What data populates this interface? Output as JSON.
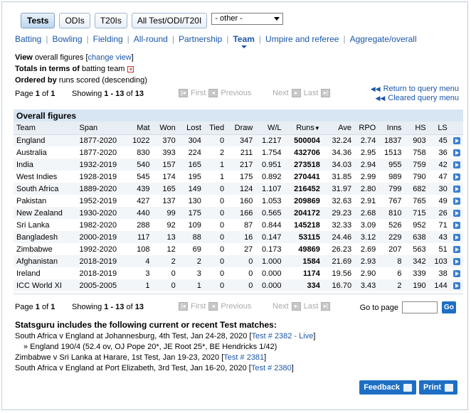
{
  "tabs": [
    {
      "label": "Tests",
      "active": true
    },
    {
      "label": "ODIs",
      "active": false
    },
    {
      "label": "T20Is",
      "active": false
    },
    {
      "label": "All Test/ODI/T20I",
      "active": false
    }
  ],
  "other_select": {
    "value": "- other -"
  },
  "subnav": [
    "Batting",
    "Bowling",
    "Fielding",
    "All-round",
    "Partnership",
    "Team",
    "Umpire and referee",
    "Aggregate/overall"
  ],
  "subnav_current": "Team",
  "info": {
    "view_label": "View",
    "view_text": "overall figures",
    "change_view": "change view",
    "totals_label": "Totals in terms of",
    "totals_value": "batting team",
    "ordered_label": "Ordered by",
    "ordered_value": "runs scored (descending)"
  },
  "pager": {
    "page_text": "Page",
    "page_current": "1",
    "of_text": "of",
    "page_total": "1",
    "showing_text": "Showing",
    "range": "1 - 13",
    "range_of": "13",
    "first": "First",
    "previous": "Previous",
    "next": "Next",
    "last": "Last"
  },
  "query_links": {
    "return": "Return to query menu",
    "cleared": "Cleared query menu"
  },
  "table": {
    "caption": "Overall figures",
    "columns": [
      "Team",
      "Span",
      "Mat",
      "Won",
      "Lost",
      "Tied",
      "Draw",
      "W/L",
      "Runs",
      "Ave",
      "RPO",
      "Inns",
      "HS",
      "LS"
    ],
    "rows": [
      [
        "England",
        "1877-2020",
        "1022",
        "370",
        "304",
        "0",
        "347",
        "1.217",
        "500004",
        "32.24",
        "2.74",
        "1837",
        "903",
        "45"
      ],
      [
        "Australia",
        "1877-2020",
        "830",
        "393",
        "224",
        "2",
        "211",
        "1.754",
        "432706",
        "34.36",
        "2.95",
        "1513",
        "758",
        "36"
      ],
      [
        "India",
        "1932-2019",
        "540",
        "157",
        "165",
        "1",
        "217",
        "0.951",
        "273518",
        "34.03",
        "2.94",
        "955",
        "759",
        "42"
      ],
      [
        "West Indies",
        "1928-2019",
        "545",
        "174",
        "195",
        "1",
        "175",
        "0.892",
        "270441",
        "31.85",
        "2.99",
        "989",
        "790",
        "47"
      ],
      [
        "South Africa",
        "1889-2020",
        "439",
        "165",
        "149",
        "0",
        "124",
        "1.107",
        "216452",
        "31.97",
        "2.80",
        "799",
        "682",
        "30"
      ],
      [
        "Pakistan",
        "1952-2019",
        "427",
        "137",
        "130",
        "0",
        "160",
        "1.053",
        "209869",
        "32.63",
        "2.91",
        "767",
        "765",
        "49"
      ],
      [
        "New Zealand",
        "1930-2020",
        "440",
        "99",
        "175",
        "0",
        "166",
        "0.565",
        "204172",
        "29.23",
        "2.68",
        "810",
        "715",
        "26"
      ],
      [
        "Sri Lanka",
        "1982-2020",
        "288",
        "92",
        "109",
        "0",
        "87",
        "0.844",
        "145218",
        "32.33",
        "3.09",
        "526",
        "952",
        "71"
      ],
      [
        "Bangladesh",
        "2000-2019",
        "117",
        "13",
        "88",
        "0",
        "16",
        "0.147",
        "53115",
        "24.46",
        "3.12",
        "229",
        "638",
        "43"
      ],
      [
        "Zimbabwe",
        "1992-2020",
        "108",
        "12",
        "69",
        "0",
        "27",
        "0.173",
        "49869",
        "26.23",
        "2.69",
        "207",
        "563",
        "51"
      ],
      [
        "Afghanistan",
        "2018-2019",
        "4",
        "2",
        "2",
        "0",
        "0",
        "1.000",
        "1584",
        "21.69",
        "2.93",
        "8",
        "342",
        "103"
      ],
      [
        "Ireland",
        "2018-2019",
        "3",
        "0",
        "3",
        "0",
        "0",
        "0.000",
        "1174",
        "19.56",
        "2.90",
        "6",
        "339",
        "38"
      ],
      [
        "ICC World XI",
        "2005-2005",
        "1",
        "0",
        "1",
        "0",
        "0",
        "0.000",
        "334",
        "16.70",
        "3.43",
        "2",
        "190",
        "144"
      ]
    ]
  },
  "goto": {
    "label": "Go to page",
    "button": "Go"
  },
  "matches": {
    "heading": "Statsguru includes the following current or recent Test matches:",
    "items": [
      {
        "text": "South Africa v England at Johannesburg, 4th Test, Jan 24-28, 2020",
        "link": "Test # 2382 - Live",
        "detail": "» England 190/4 (52.4 ov, OJ Pope 20*, JE Root 25*, BE Hendricks 1/42)"
      },
      {
        "text": "Zimbabwe v Sri Lanka at Harare, 1st Test, Jan 19-23, 2020",
        "link": "Test # 2381",
        "detail": ""
      },
      {
        "text": "South Africa v England at Port Elizabeth, 3rd Test, Jan 16-20, 2020",
        "link": "Test # 2380",
        "detail": ""
      }
    ]
  },
  "buttons": {
    "feedback": "Feedback",
    "print": "Print"
  }
}
